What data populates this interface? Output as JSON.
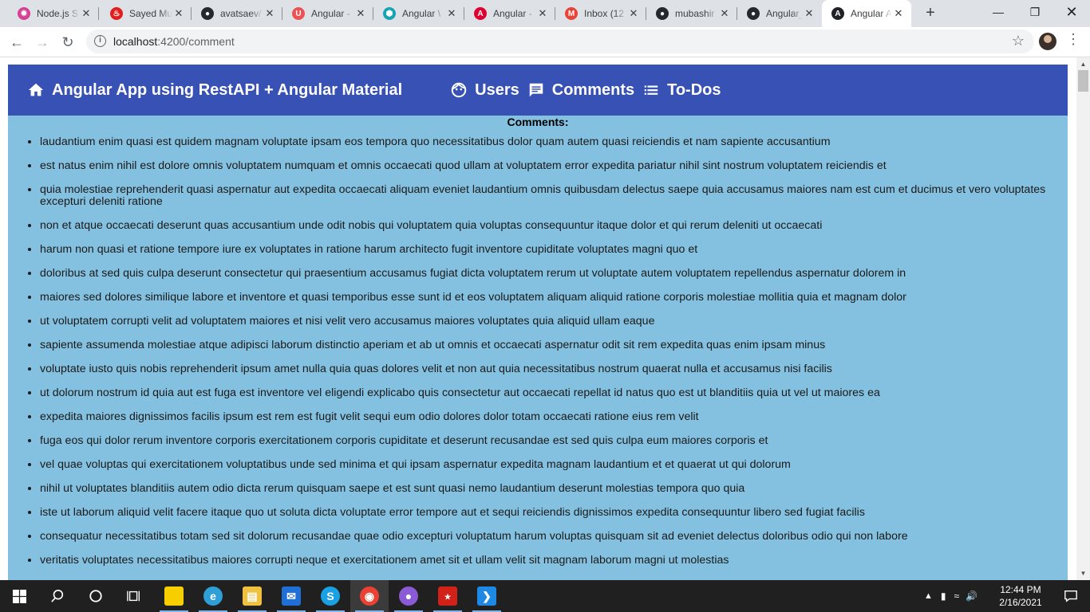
{
  "browser": {
    "tabs": [
      {
        "title": "Node.js S",
        "icon": "nodejs-icon",
        "color": "#d64292"
      },
      {
        "title": "Sayed Mu",
        "icon": "java-icon",
        "color": "#e11d1d"
      },
      {
        "title": "avatsaev/",
        "icon": "github-icon",
        "color": "#24292e"
      },
      {
        "title": "Angular -",
        "icon": "udemy-icon",
        "color": "#ec5252"
      },
      {
        "title": "Angular \\",
        "icon": "hexagon-icon",
        "color": "#15a3b5"
      },
      {
        "title": "Angular -",
        "icon": "angular-icon",
        "color": "#dd0031"
      },
      {
        "title": "Inbox (12",
        "icon": "gmail-icon",
        "color": "#ea4335"
      },
      {
        "title": "mubashir",
        "icon": "github-icon",
        "color": "#24292e"
      },
      {
        "title": "Angular_l",
        "icon": "github-icon",
        "color": "#24292e"
      },
      {
        "title": "Angular A",
        "icon": "angular-icon",
        "color": "#202124"
      }
    ],
    "url_host": "localhost",
    "url_rest": ":4200/comment"
  },
  "app": {
    "brand": "Angular App using RestAPI + Angular Material",
    "nav": {
      "users": "Users",
      "comments": "Comments",
      "todos": "To-Dos"
    },
    "section_title": "Comments:",
    "comments": [
      "laudantium enim quasi est quidem magnam voluptate ipsam eos tempora quo necessitatibus dolor quam autem quasi reiciendis et nam sapiente accusantium",
      "est natus enim nihil est dolore omnis voluptatem numquam et omnis occaecati quod ullam at voluptatem error expedita pariatur nihil sint nostrum voluptatem reiciendis et",
      "quia molestiae reprehenderit quasi aspernatur aut expedita occaecati aliquam eveniet laudantium omnis quibusdam delectus saepe quia accusamus maiores nam est cum et ducimus et vero voluptates excepturi deleniti ratione",
      "non et atque occaecati deserunt quas accusantium unde odit nobis qui voluptatem quia voluptas consequuntur itaque dolor et qui rerum deleniti ut occaecati",
      "harum non quasi et ratione tempore iure ex voluptates in ratione harum architecto fugit inventore cupiditate voluptates magni quo et",
      "doloribus at sed quis culpa deserunt consectetur qui praesentium accusamus fugiat dicta voluptatem rerum ut voluptate autem voluptatem repellendus aspernatur dolorem in",
      "maiores sed dolores similique labore et inventore et quasi temporibus esse sunt id et eos voluptatem aliquam aliquid ratione corporis molestiae mollitia quia et magnam dolor",
      "ut voluptatem corrupti velit ad voluptatem maiores et nisi velit vero accusamus maiores voluptates quia aliquid ullam eaque",
      "sapiente assumenda molestiae atque adipisci laborum distinctio aperiam et ab ut omnis et occaecati aspernatur odit sit rem expedita quas enim ipsam minus",
      "voluptate iusto quis nobis reprehenderit ipsum amet nulla quia quas dolores velit et non aut quia necessitatibus nostrum quaerat nulla et accusamus nisi facilis",
      "ut dolorum nostrum id quia aut est fuga est inventore vel eligendi explicabo quis consectetur aut occaecati repellat id natus quo est ut blanditiis quia ut vel ut maiores ea",
      "expedita maiores dignissimos facilis ipsum est rem est fugit velit sequi eum odio dolores dolor totam occaecati ratione eius rem velit",
      "fuga eos qui dolor rerum inventore corporis exercitationem corporis cupiditate et deserunt recusandae est sed quis culpa eum maiores corporis et",
      "vel quae voluptas qui exercitationem voluptatibus unde sed minima et qui ipsam aspernatur expedita magnam laudantium et et quaerat ut qui dolorum",
      "nihil ut voluptates blanditiis autem odio dicta rerum quisquam saepe et est sunt quasi nemo laudantium deserunt molestias tempora quo quia",
      "iste ut laborum aliquid velit facere itaque quo ut soluta dicta voluptate error tempore aut et sequi reiciendis dignissimos expedita consequuntur libero sed fugiat facilis",
      "consequatur necessitatibus totam sed sit dolorum recusandae quae odio excepturi voluptatum harum voluptas quisquam sit ad eveniet delectus doloribus odio qui non labore",
      "veritatis voluptates necessitatibus maiores corrupti neque et exercitationem amet sit et ullam velit sit magnam laborum magni ut molestias"
    ],
    "colors": {
      "toolbar": "#3751b5",
      "background": "#84c1e0"
    }
  },
  "taskbar": {
    "time": "12:44 PM",
    "date": "2/16/2021",
    "apps": [
      {
        "name": "sticky-notes-icon",
        "color": "#f7ce00"
      },
      {
        "name": "edge-icon",
        "color": "#2f9fd8"
      },
      {
        "name": "file-explorer-icon",
        "color": "#f0c040"
      },
      {
        "name": "mail-icon",
        "color": "#1f6fd6"
      },
      {
        "name": "skype-icon",
        "color": "#1aa1e4"
      },
      {
        "name": "chrome-icon",
        "color": "#e94235"
      },
      {
        "name": "github-desktop-icon",
        "color": "#8a5bd4"
      },
      {
        "name": "acrobat-icon",
        "color": "#d22119"
      },
      {
        "name": "vscode-icon",
        "color": "#1e88e5"
      }
    ]
  }
}
